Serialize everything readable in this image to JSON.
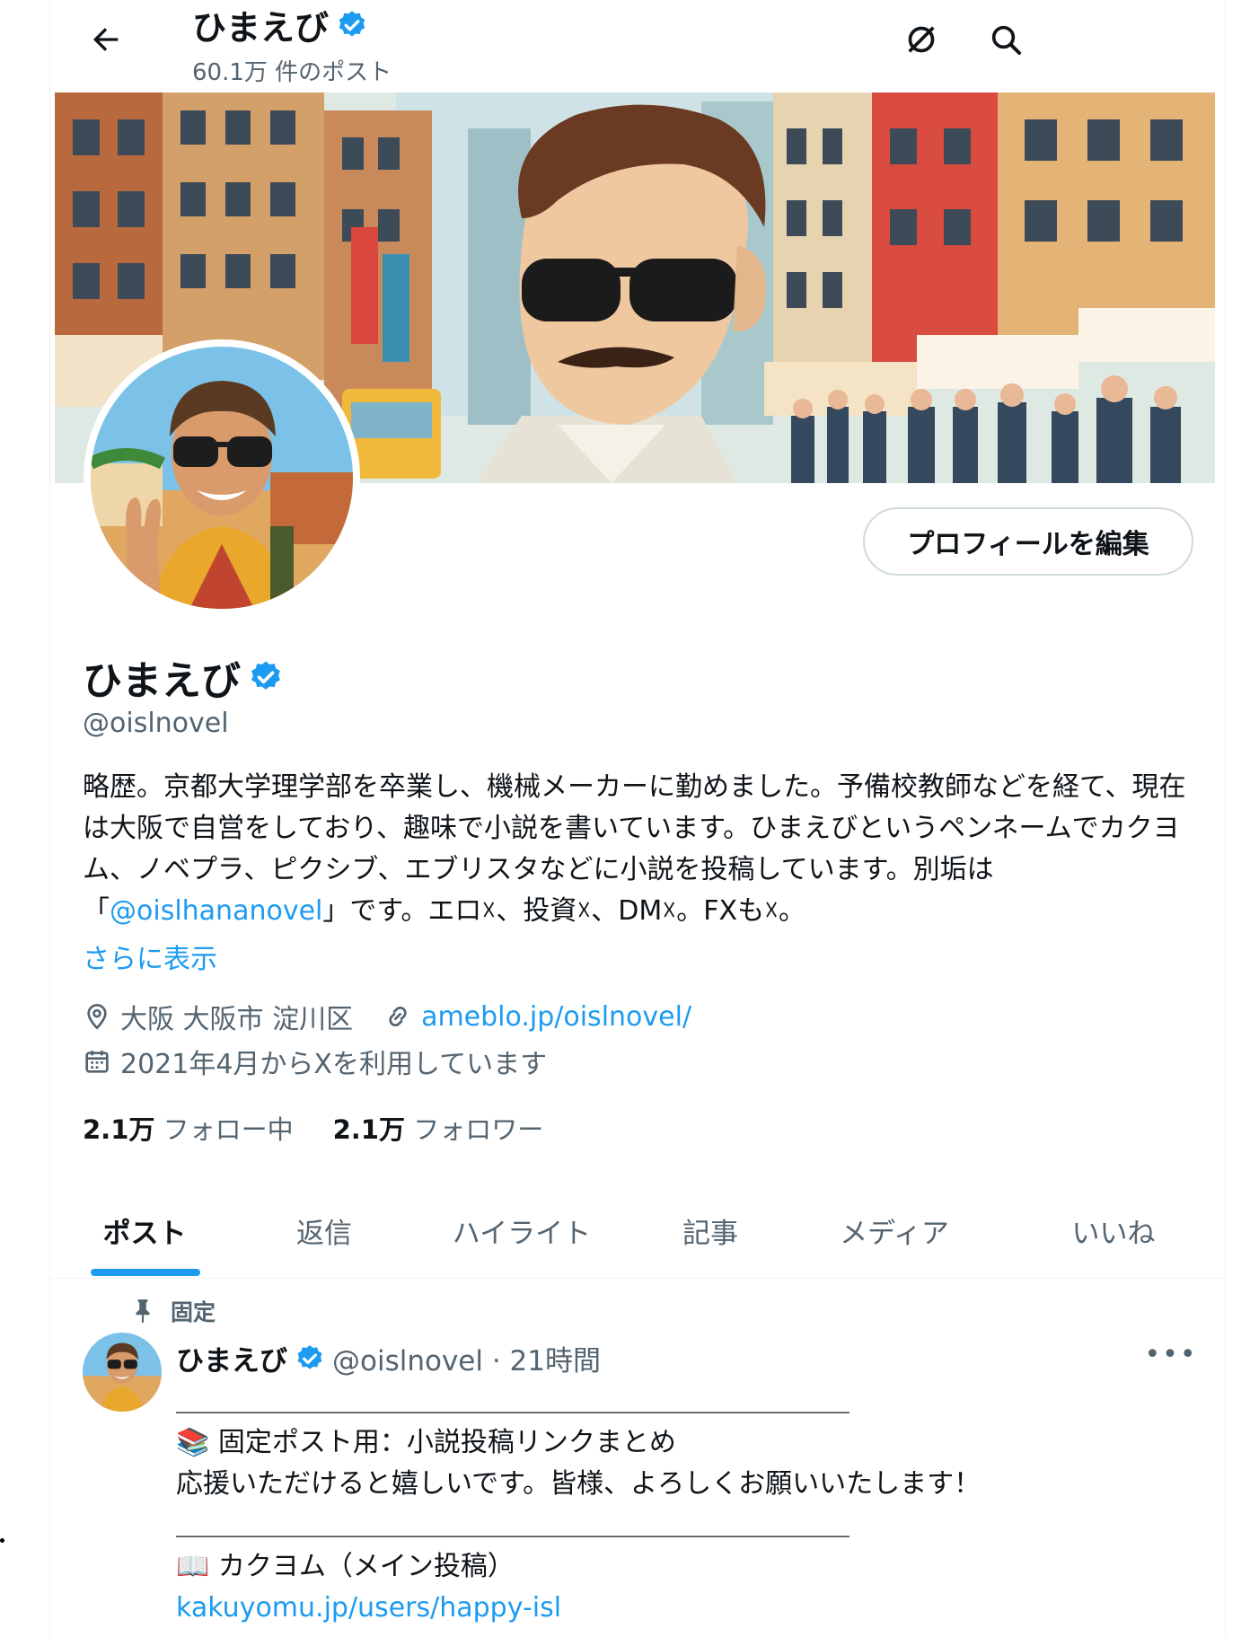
{
  "header": {
    "name": "ひまえび",
    "post_count": "60.1万 件のポスト"
  },
  "profile": {
    "name": "ひまえび",
    "handle": "@oislnovel",
    "edit_button": "プロフィールを編集",
    "bio_part1": "略歴。京都大学理学部を卒業し、機械メーカーに勤めました。予備校教師などを経て、現在は大阪で自営をしており、趣味で小説を書いています。ひまえびというペンネームでカクヨム、ノベプラ、ピクシブ、エブリスタなどに小説を投稿しています。別垢は「",
    "bio_mention": "@oislhananovel",
    "bio_part2": "」です。エロ☓、投資☓、DM☓。FXも☓。",
    "show_more": "さらに表示",
    "location": "大阪 大阪市 淀川区",
    "website": "ameblo.jp/oislnovel/",
    "joined": "2021年4月からXを利用しています",
    "following_count": "2.1万",
    "following_label": "フォロー中",
    "followers_count": "2.1万",
    "followers_label": "フォロワー"
  },
  "tabs": [
    "ポスト",
    "返信",
    "ハイライト",
    "記事",
    "メディア",
    "いいね"
  ],
  "pinned_post": {
    "pinned_label": "固定",
    "name": "ひまえび",
    "handle_time": "@oislnovel · 21時間",
    "more": "•••",
    "rule": "＿＿＿＿＿＿＿＿＿＿＿＿＿＿＿＿＿＿＿＿＿＿＿＿＿",
    "line1": "📚 固定ポスト用：小説投稿リンクまとめ",
    "line2": "応援いただけると嬉しいです。皆様、よろしくお願いいたします！",
    "rule2": "＿＿＿＿＿＿＿＿＿＿＿＿＿＿＿＿＿＿＿＿＿＿＿＿＿",
    "line3": "📖 カクヨム（メイン投稿）",
    "link": "kakuyomu.jp/users/happy-isl"
  },
  "colors": {
    "accent": "#1d9bf0",
    "secondary_text": "#536471",
    "primary_text": "#0f1419",
    "border": "#eff3f4"
  },
  "icons": {
    "back": "arrow-left-icon",
    "verified": "verified-badge-icon",
    "grok": "grok-icon",
    "search": "search-icon",
    "location": "location-pin-icon",
    "link": "link-icon",
    "calendar": "calendar-icon",
    "pin": "pin-icon",
    "more": "more-icon"
  }
}
